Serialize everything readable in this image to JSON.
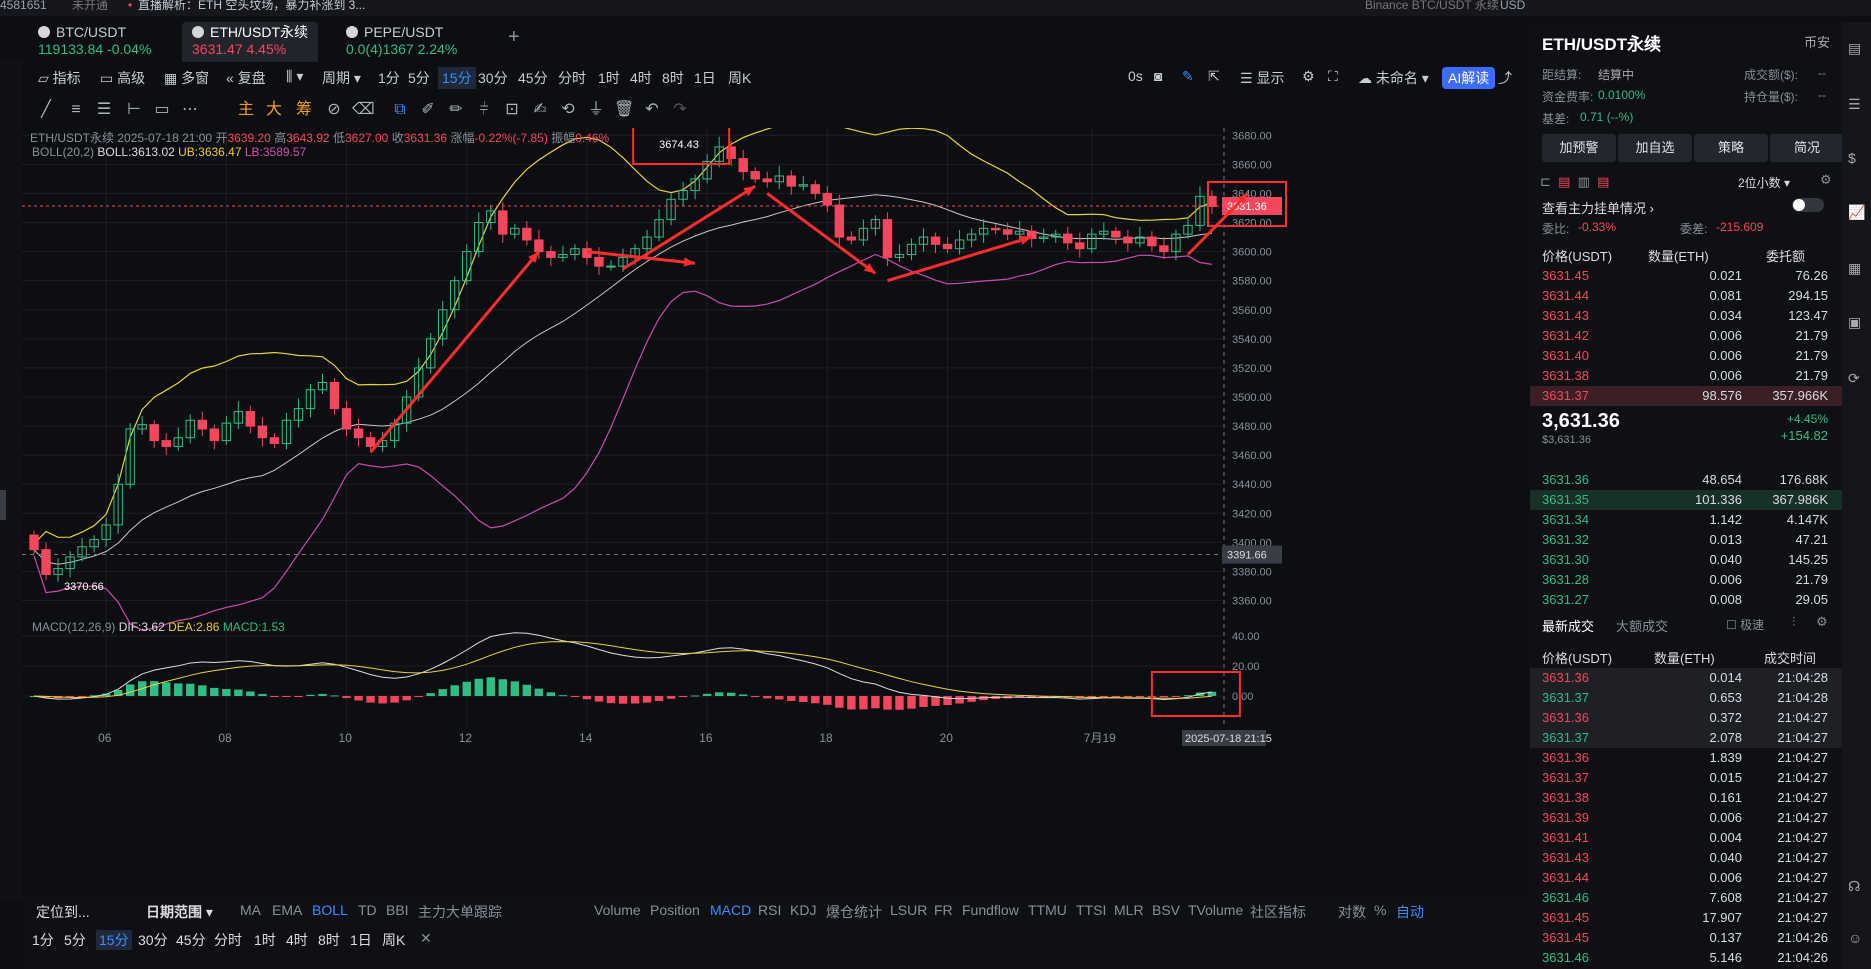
{
  "topbar": {
    "left_number": "4581651",
    "status": "未开通",
    "news": "直播解析：ETH 空头坟场，暴力补涨到 3...",
    "search_placeholder": "Binance BTC/USDT 永续",
    "currency": "USD"
  },
  "tabs": [
    {
      "name": "BTC/USDT",
      "price": "119133.84",
      "change": "-0.04%"
    },
    {
      "name": "ETH/USDT永续",
      "price": "3631.47",
      "change": "4.45%"
    },
    {
      "name": "PEPE/USDT",
      "price": "0.0(4)1367",
      "change": "2.24%"
    }
  ],
  "toolbar": {
    "indicators": "指标",
    "advanced": "高级",
    "multiwindow": "多窗",
    "replay": "复盘",
    "period": "周期",
    "intervals": [
      "1分",
      "5分",
      "15分",
      "30分",
      "45分",
      "分时",
      "1时",
      "4时",
      "8时",
      "1日",
      "周K"
    ],
    "selected_interval": "15分",
    "countdown": "0s",
    "display": "显示",
    "unnamed": "未命名",
    "ai": "AI解读"
  },
  "drawbar": {
    "labels": [
      "主",
      "大",
      "筹"
    ]
  },
  "chart_data": {
    "type": "candlestick",
    "symbol": "ETH/USDT永续",
    "interval": "15分",
    "header": {
      "time": "2025-07-18 21:00",
      "open_label": "开",
      "open": "3639.20",
      "high_label": "高",
      "high": "3643.92",
      "low_label": "低",
      "low": "3627.00",
      "close_label": "收",
      "close": "3631.36",
      "change_label": "涨幅",
      "change": "-0.22%(-7.85)",
      "amp_label": "振幅",
      "amplitude": "0.46%"
    },
    "boll": {
      "label": "BOLL(20,2)",
      "boll": "BOLL:3613.02",
      "ub": "UB:3636.47",
      "lb": "LB:3589.57"
    },
    "y_axis": {
      "ticks": [
        "3680.00",
        "3660.00",
        "3640.00",
        "3620.00",
        "3600.00",
        "3580.00",
        "3560.00",
        "3540.00",
        "3520.00",
        "3500.00",
        "3480.00",
        "3460.00",
        "3440.00",
        "3420.00",
        "3400.00",
        "3380.00",
        "3360.00"
      ],
      "range": [
        3348,
        3685
      ]
    },
    "x_axis": {
      "ticks": [
        "06",
        "08",
        "10",
        "12",
        "14",
        "16",
        "18",
        "20",
        "7月19"
      ]
    },
    "current_price": "3631.36",
    "crosshair_price": "3391.66",
    "crosshair_time": "2025-07-18 21:15",
    "annotations": {
      "high_label": "3674.43",
      "low_label": "3370.66"
    },
    "close_series": [
      3395,
      3378,
      3382,
      3390,
      3397,
      3402,
      3412,
      3440,
      3478,
      3481,
      3470,
      3466,
      3472,
      3484,
      3478,
      3470,
      3482,
      3490,
      3480,
      3472,
      3468,
      3484,
      3492,
      3505,
      3510,
      3492,
      3478,
      3472,
      3466,
      3470,
      3482,
      3500,
      3520,
      3540,
      3560,
      3580,
      3600,
      3620,
      3628,
      3612,
      3616,
      3608,
      3600,
      3596,
      3598,
      3602,
      3596,
      3590,
      3590,
      3596,
      3602,
      3610,
      3622,
      3636,
      3642,
      3650,
      3662,
      3672,
      3664,
      3655,
      3650,
      3648,
      3652,
      3645,
      3646,
      3640,
      3632,
      3610,
      3608,
      3616,
      3622,
      3596,
      3598,
      3605,
      3610,
      3605,
      3602,
      3608,
      3612,
      3616,
      3615,
      3612,
      3614,
      3609,
      3610,
      3612,
      3606,
      3602,
      3612,
      3614,
      3610,
      3606,
      3610,
      3604,
      3600,
      3612,
      3618,
      3638,
      3631
    ],
    "macd": {
      "label": "MACD(12,26,9)",
      "dif": "DIF:3.62",
      "dea": "DEA:2.86",
      "macd": "MACD:1.53",
      "y_ticks": [
        "40.00",
        "20.00",
        "0.00"
      ]
    }
  },
  "bottom": {
    "locate": "定位到...",
    "date_range": "日期范围",
    "main_indicators": [
      "MA",
      "EMA",
      "BOLL",
      "TD",
      "BBI",
      "主力大单跟踪"
    ],
    "sub_indicators": [
      "Volume",
      "Position",
      "MACD",
      "RSI",
      "KDJ",
      "爆仓统计",
      "LSUR",
      "FR",
      "Fundflow",
      "TTMU",
      "TTSI",
      "MLR",
      "BSV",
      "TVolume"
    ],
    "community": "社区指标",
    "log": "对数",
    "pct": "%",
    "auto": "自动",
    "intervals": [
      "1分",
      "5分",
      "15分",
      "30分",
      "45分",
      "分时",
      "1时",
      "4时",
      "8时",
      "1日",
      "周K"
    ]
  },
  "panel": {
    "title": "ETH/USDT永续",
    "exchange": "币安",
    "settle_label": "距结算:",
    "settle": "结算中",
    "vol_label": "成交额($):",
    "vol": "--",
    "rate_label": "资金费率:",
    "rate": "0.0100%",
    "oi_label": "持仓量($):",
    "oi": "--",
    "basis_label": "基差:",
    "basis": "0.71 (--%)",
    "buttons": [
      "加预警",
      "加自选",
      "策略",
      "简况"
    ],
    "precision": "2位小数",
    "main_orders": "查看主力挂单情况",
    "ratio_label": "委比:",
    "ratio": "-0.33%",
    "diff_label": "委差:",
    "diff": "-215.609",
    "ob_headers": [
      "价格(USDT)",
      "数量(ETH)",
      "委托额"
    ],
    "asks": [
      {
        "p": "3631.45",
        "q": "0.021",
        "t": "76.26"
      },
      {
        "p": "3631.44",
        "q": "0.081",
        "t": "294.15"
      },
      {
        "p": "3631.43",
        "q": "0.034",
        "t": "123.47"
      },
      {
        "p": "3631.42",
        "q": "0.006",
        "t": "21.79"
      },
      {
        "p": "3631.40",
        "q": "0.006",
        "t": "21.79"
      },
      {
        "p": "3631.38",
        "q": "0.006",
        "t": "21.79"
      },
      {
        "p": "3631.37",
        "q": "98.576",
        "t": "357.966K"
      }
    ],
    "last_price": "3,631.36",
    "last_price_usd": "$3,631.36",
    "last_change_pct": "+4.45%",
    "last_change": "+154.82",
    "bids": [
      {
        "p": "3631.36",
        "q": "48.654",
        "t": "176.68K"
      },
      {
        "p": "3631.35",
        "q": "101.336",
        "t": "367.986K"
      },
      {
        "p": "3631.34",
        "q": "1.142",
        "t": "4.147K"
      },
      {
        "p": "3631.32",
        "q": "0.013",
        "t": "47.21"
      },
      {
        "p": "3631.30",
        "q": "0.040",
        "t": "145.25"
      },
      {
        "p": "3631.28",
        "q": "0.006",
        "t": "21.79"
      },
      {
        "p": "3631.27",
        "q": "0.008",
        "t": "29.05"
      }
    ],
    "trades_tab": "最新成交",
    "big_trades_tab": "大额成交",
    "fast": "极速",
    "trade_headers": [
      "价格(USDT)",
      "数量(ETH)",
      "成交时间"
    ],
    "trades": [
      {
        "p": "3631.36",
        "q": "0.014",
        "t": "21:04:28",
        "s": "sell"
      },
      {
        "p": "3631.37",
        "q": "0.653",
        "t": "21:04:28",
        "s": "buy"
      },
      {
        "p": "3631.36",
        "q": "0.372",
        "t": "21:04:27",
        "s": "sell"
      },
      {
        "p": "3631.37",
        "q": "2.078",
        "t": "21:04:27",
        "s": "buy"
      },
      {
        "p": "3631.36",
        "q": "1.839",
        "t": "21:04:27",
        "s": "sell"
      },
      {
        "p": "3631.37",
        "q": "0.015",
        "t": "21:04:27",
        "s": "sell"
      },
      {
        "p": "3631.38",
        "q": "0.161",
        "t": "21:04:27",
        "s": "sell"
      },
      {
        "p": "3631.39",
        "q": "0.006",
        "t": "21:04:27",
        "s": "sell"
      },
      {
        "p": "3631.41",
        "q": "0.004",
        "t": "21:04:27",
        "s": "sell"
      },
      {
        "p": "3631.43",
        "q": "0.040",
        "t": "21:04:27",
        "s": "sell"
      },
      {
        "p": "3631.44",
        "q": "0.006",
        "t": "21:04:27",
        "s": "sell"
      },
      {
        "p": "3631.46",
        "q": "7.608",
        "t": "21:04:27",
        "s": "buy"
      },
      {
        "p": "3631.45",
        "q": "17.907",
        "t": "21:04:27",
        "s": "sell"
      },
      {
        "p": "3631.45",
        "q": "0.137",
        "t": "21:04:26",
        "s": "sell"
      },
      {
        "p": "3631.46",
        "q": "5.146",
        "t": "21:04:26",
        "s": "buy"
      }
    ]
  },
  "colors": {
    "up": "#2ebd85",
    "down": "#f6465d",
    "accent": "#3b8cff",
    "annot": "#ff2d2d",
    "boll_ub": "#e8d33a",
    "boll_mid": "#c8c8c8",
    "boll_lb": "#c94bb0"
  }
}
